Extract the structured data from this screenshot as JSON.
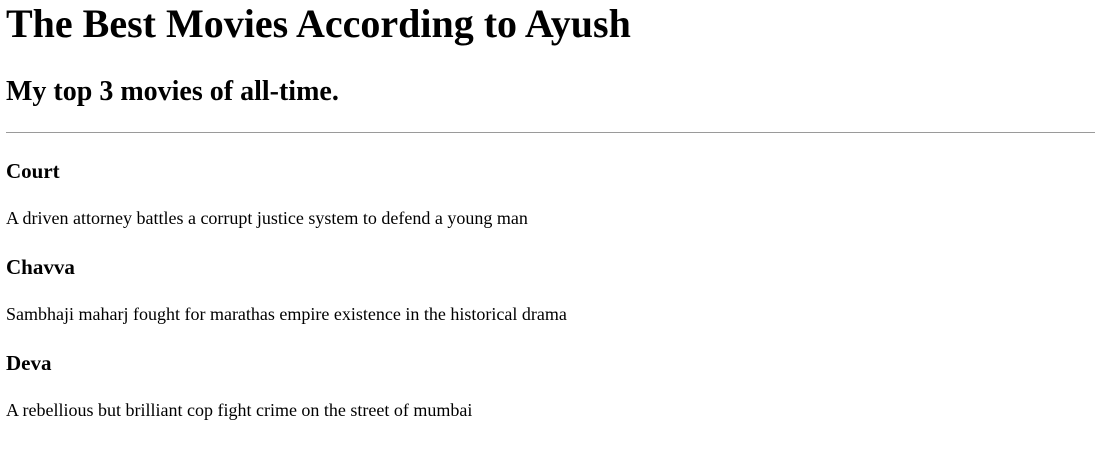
{
  "header": {
    "title": "The Best Movies According to Ayush",
    "subtitle": "My top 3 movies of all-time."
  },
  "movies": [
    {
      "title": "Court",
      "description": "A driven attorney battles a corrupt justice system to defend a young man"
    },
    {
      "title": "Chavva",
      "description": "Sambhaji maharj fought for marathas empire existence in the historical drama"
    },
    {
      "title": "Deva",
      "description": "A rebellious but brilliant cop fight crime on the street of mumbai"
    }
  ]
}
